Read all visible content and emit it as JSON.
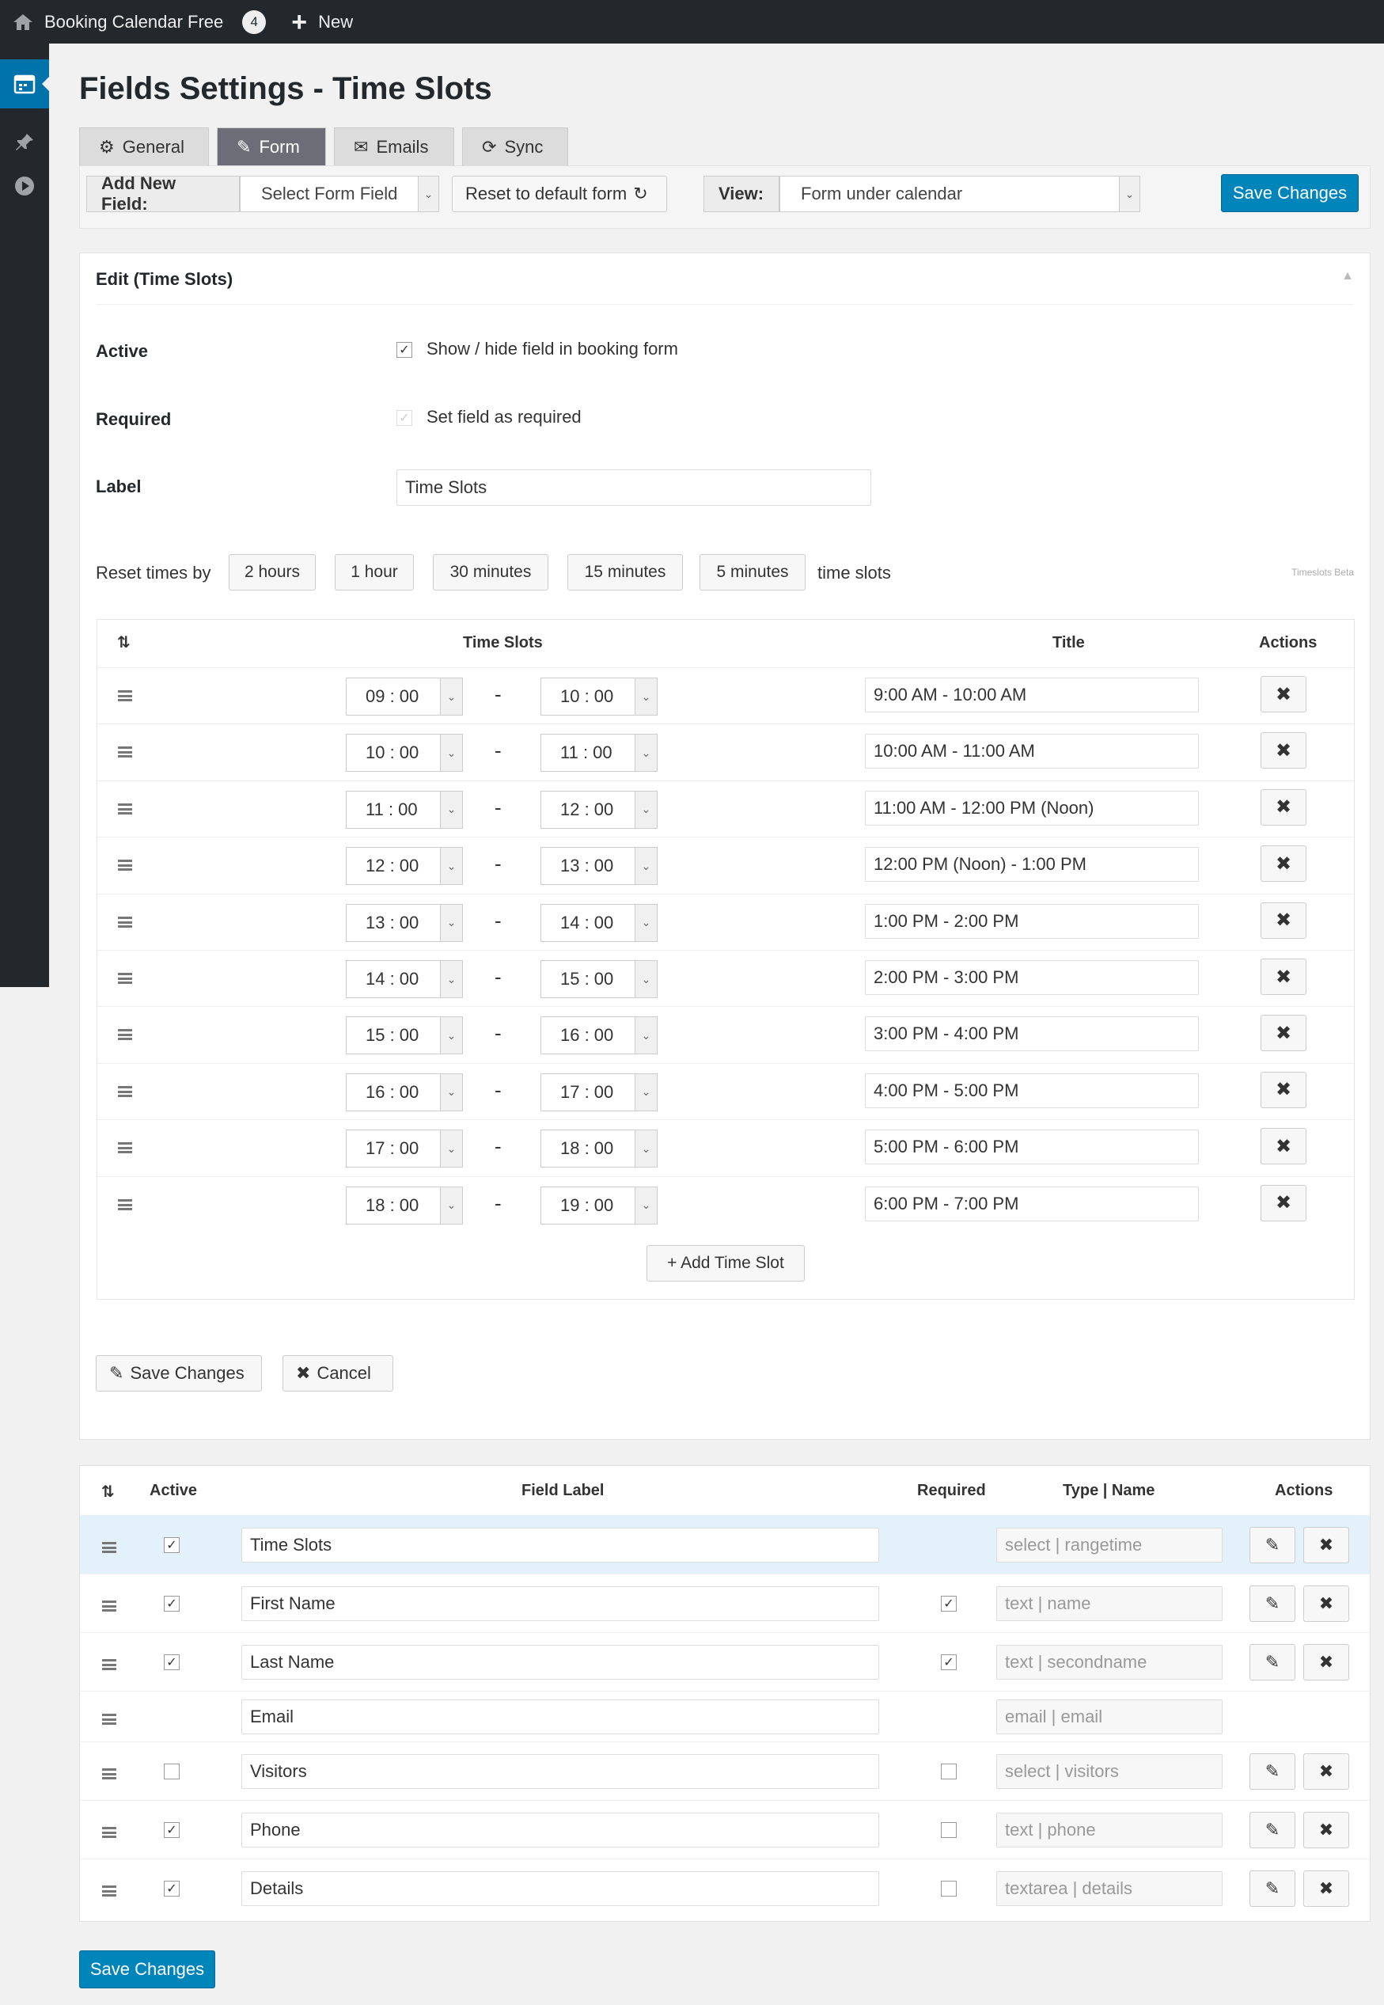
{
  "adminbar": {
    "site_title": "Booking Calendar Free",
    "badge": "4",
    "new_label": "New"
  },
  "page": {
    "title": "Fields Settings - Time Slots"
  },
  "tabs": [
    {
      "label": "General",
      "icon": "gear-icon"
    },
    {
      "label": "Form",
      "icon": "edit-icon",
      "active": true
    },
    {
      "label": "Emails",
      "icon": "envelope-icon"
    },
    {
      "label": "Sync",
      "icon": "refresh-icon"
    }
  ],
  "toolbar": {
    "add_new_field_label": "Add New Field:",
    "select_field_placeholder": "Select Form Field",
    "reset_label": "Reset to default form",
    "view_label": "View:",
    "view_value": "Form under calendar",
    "save_label": "Save Changes"
  },
  "edit": {
    "heading": "Edit (Time Slots)",
    "active_label": "Active",
    "active_text": "Show / hide field in booking form",
    "required_label": "Required",
    "required_text": "Set field as required",
    "label_label": "Label",
    "label_value": "Time Slots",
    "reset_times_label": "Reset times by",
    "reset_buttons": [
      "2 hours",
      "1 hour",
      "30 minutes",
      "15 minutes",
      "5 minutes"
    ],
    "time_slots_suffix": "time slots",
    "beta_note": "Timeslots Beta",
    "columns": {
      "slots": "Time Slots",
      "title": "Title",
      "actions": "Actions"
    },
    "slots": [
      {
        "start": "09 : 00",
        "end": "10 : 00",
        "title": "9:00 AM - 10:00 AM"
      },
      {
        "start": "10 : 00",
        "end": "11 : 00",
        "title": "10:00 AM - 11:00 AM"
      },
      {
        "start": "11 : 00",
        "end": "12 : 00",
        "title": "11:00 AM - 12:00 PM (Noon)"
      },
      {
        "start": "12 : 00",
        "end": "13 : 00",
        "title": "12:00 PM (Noon) - 1:00 PM"
      },
      {
        "start": "13 : 00",
        "end": "14 : 00",
        "title": "1:00 PM - 2:00 PM"
      },
      {
        "start": "14 : 00",
        "end": "15 : 00",
        "title": "2:00 PM - 3:00 PM"
      },
      {
        "start": "15 : 00",
        "end": "16 : 00",
        "title": "3:00 PM - 4:00 PM"
      },
      {
        "start": "16 : 00",
        "end": "17 : 00",
        "title": "4:00 PM - 5:00 PM"
      },
      {
        "start": "17 : 00",
        "end": "18 : 00",
        "title": "5:00 PM - 6:00 PM"
      },
      {
        "start": "18 : 00",
        "end": "19 : 00",
        "title": "6:00 PM - 7:00 PM"
      }
    ],
    "add_slot_label": "+ Add Time Slot",
    "save_label": "Save Changes",
    "cancel_label": "Cancel"
  },
  "fields": {
    "columns": {
      "active": "Active",
      "label": "Field Label",
      "required": "Required",
      "type": "Type | Name",
      "actions": "Actions"
    },
    "rows": [
      {
        "label": "Time Slots",
        "active": true,
        "required": null,
        "type": "select | rangetime",
        "actions": true,
        "selected": true
      },
      {
        "label": "First Name",
        "active": true,
        "required": true,
        "type": "text | name",
        "actions": true
      },
      {
        "label": "Last Name",
        "active": true,
        "required": true,
        "type": "text | secondname",
        "actions": true
      },
      {
        "label": "Email",
        "active": null,
        "required": null,
        "type": "email | email",
        "actions": false
      },
      {
        "label": "Visitors",
        "active": false,
        "required": false,
        "type": "select | visitors",
        "actions": true
      },
      {
        "label": "Phone",
        "active": true,
        "required": false,
        "type": "text | phone",
        "actions": true
      },
      {
        "label": "Details",
        "active": true,
        "required": false,
        "type": "textarea | details",
        "actions": true
      }
    ]
  },
  "footer": {
    "save_label": "Save Changes"
  }
}
